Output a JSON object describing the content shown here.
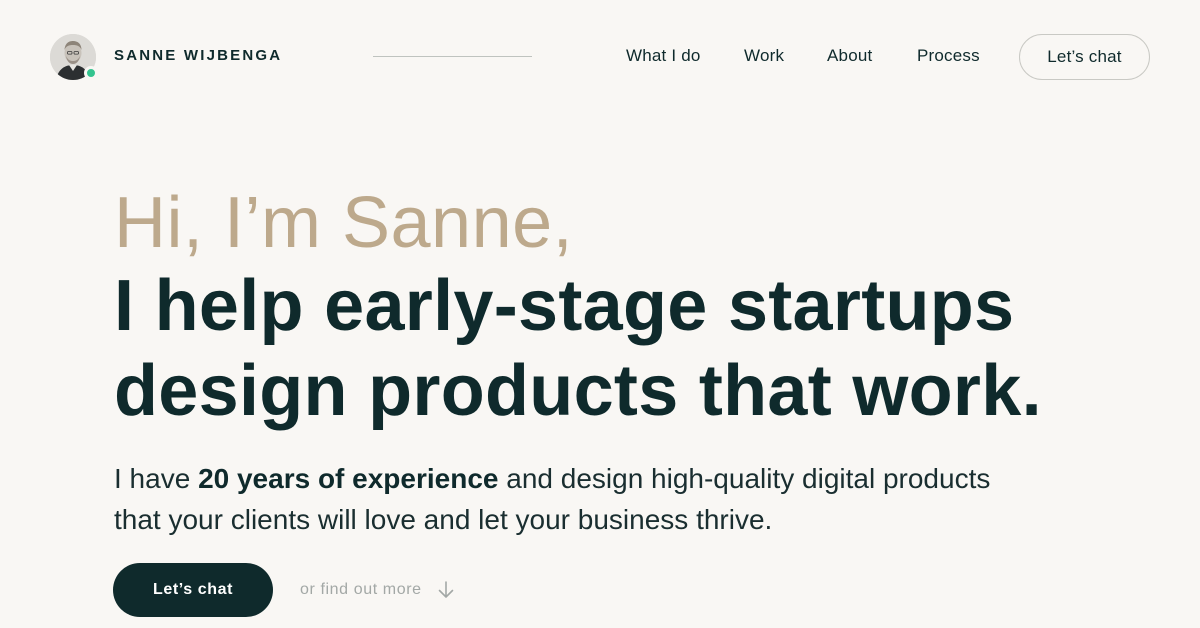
{
  "header": {
    "brand_name": "SANNE WIJBENGA",
    "avatar": {
      "icon": "person-photo-icon",
      "status": "online",
      "status_color": "#34c48f"
    },
    "nav": [
      {
        "label": "What I do"
      },
      {
        "label": "Work"
      },
      {
        "label": "About"
      },
      {
        "label": "Process"
      }
    ],
    "cta_label": "Let’s chat"
  },
  "hero": {
    "greeting": "Hi, I’m Sanne,",
    "headline_line1": "I help early-stage startups",
    "headline_line2": "design products that work.",
    "intro_prefix": "I have ",
    "intro_bold": "20 years of experience",
    "intro_suffix": " and design high-quality digital products that your clients will love and let your business thrive.",
    "primary_cta": "Let’s chat",
    "secondary_cta": "or find out more",
    "secondary_icon": "arrow-down-icon"
  },
  "colors": {
    "background": "#f9f7f4",
    "text": "#0f2a2c",
    "accent_tan": "#bda98c",
    "button_dark": "#0f2a2c",
    "muted": "#a3a8a6"
  }
}
